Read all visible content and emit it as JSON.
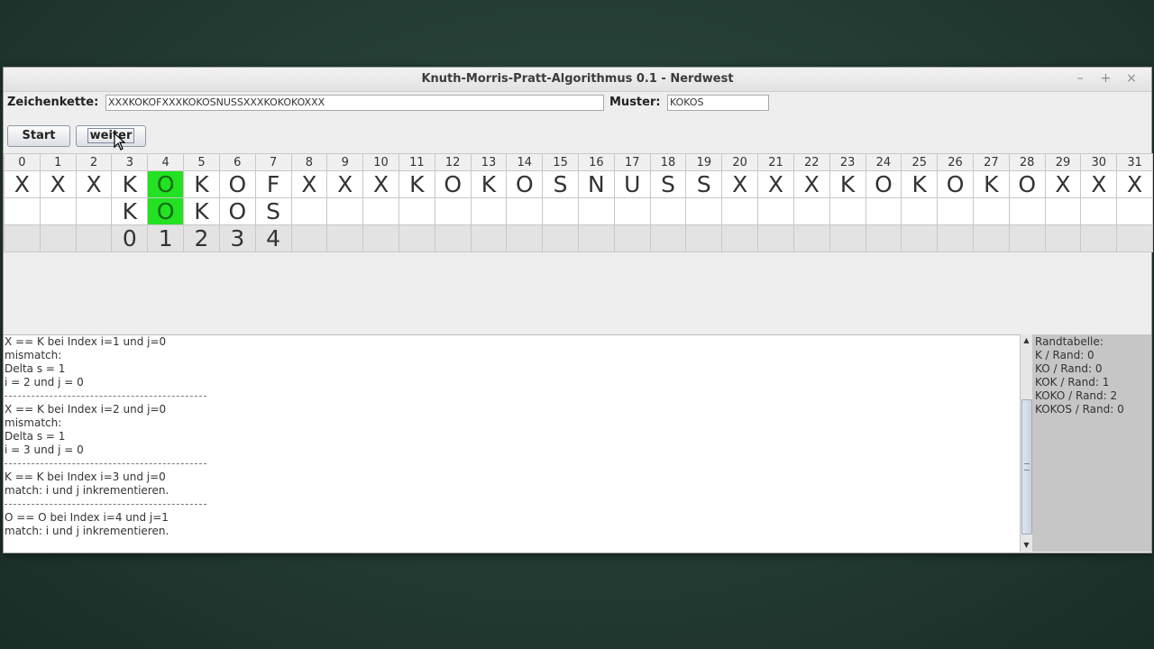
{
  "window": {
    "title": "Knuth-Morris-Pratt-Algorithmus 0.1 - Nerdwest",
    "controls": [
      "–",
      "+",
      "×"
    ]
  },
  "inputs": {
    "text_label": "Zeichenkette:",
    "text_value": "XXXKOKOFXXXKOKOSNUSSXXXKOKOKOXXX",
    "pattern_label": "Muster:",
    "pattern_value": "KOKOS"
  },
  "buttons": {
    "start": "Start",
    "next": "weiter"
  },
  "grid": {
    "indices": [
      "0",
      "1",
      "2",
      "3",
      "4",
      "5",
      "6",
      "7",
      "8",
      "9",
      "10",
      "11",
      "12",
      "13",
      "14",
      "15",
      "16",
      "17",
      "18",
      "19",
      "20",
      "21",
      "22",
      "23",
      "24",
      "25",
      "26",
      "27",
      "28",
      "29",
      "30",
      "31"
    ],
    "text_row": [
      "X",
      "X",
      "X",
      "K",
      "O",
      "K",
      "O",
      "F",
      "X",
      "X",
      "X",
      "K",
      "O",
      "K",
      "O",
      "S",
      "N",
      "U",
      "S",
      "S",
      "X",
      "X",
      "X",
      "K",
      "O",
      "K",
      "O",
      "K",
      "O",
      "X",
      "X",
      "X"
    ],
    "pattern_row": [
      "",
      "",
      "",
      "K",
      "O",
      "K",
      "O",
      "S",
      "",
      "",
      "",
      "",
      "",
      "",
      "",
      "",
      "",
      "",
      "",
      "",
      "",
      "",
      "",
      "",
      "",
      "",
      "",
      "",
      "",
      "",
      "",
      ""
    ],
    "prefix_row": [
      "",
      "",
      "",
      "0",
      "1",
      "2",
      "3",
      "4",
      "",
      "",
      "",
      "",
      "",
      "",
      "",
      "",
      "",
      "",
      "",
      "",
      "",
      "",
      "",
      "",
      "",
      "",
      "",
      "",
      "",
      "",
      "",
      ""
    ],
    "highlight_index": 4,
    "highlight_color": "#22e222"
  },
  "log": [
    "X == K bei Index i=1 und j=0",
    "mismatch:",
    "Delta s = 1",
    "i = 2 und j = 0",
    "---",
    "X == K bei Index i=2 und j=0",
    "mismatch:",
    "Delta s = 1",
    "i = 3 und j = 0",
    "---",
    "K == K bei Index i=3 und j=0",
    "match: i und j inkrementieren.",
    "---",
    "O == O bei Index i=4 und j=1",
    "match: i und j inkrementieren."
  ],
  "rand_table": {
    "title": "Randtabelle:",
    "entries": [
      "K / Rand: 0",
      "KO / Rand: 0",
      "KOK / Rand: 1",
      "KOKO / Rand: 2",
      "KOKOS / Rand: 0"
    ]
  }
}
